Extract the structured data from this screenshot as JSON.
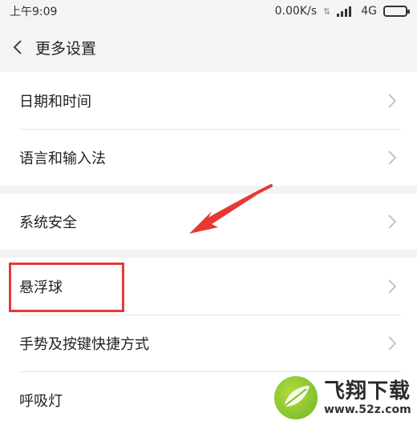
{
  "status_bar": {
    "time": "上午9:09",
    "speed": "0.00K/s",
    "network": "4G"
  },
  "header": {
    "title": "更多设置"
  },
  "settings_groups": [
    {
      "items": [
        {
          "label": "日期和时间"
        },
        {
          "label": "语言和输入法"
        }
      ]
    },
    {
      "items": [
        {
          "label": "系统安全"
        }
      ]
    },
    {
      "items": [
        {
          "label": "悬浮球"
        },
        {
          "label": "手势及按键快捷方式"
        },
        {
          "label": "呼吸灯"
        }
      ]
    }
  ],
  "watermark": {
    "name": "飞翔下载",
    "url": "www.52z.com"
  },
  "colors": {
    "highlight": "#e53935",
    "background": "#f2f2f2"
  }
}
